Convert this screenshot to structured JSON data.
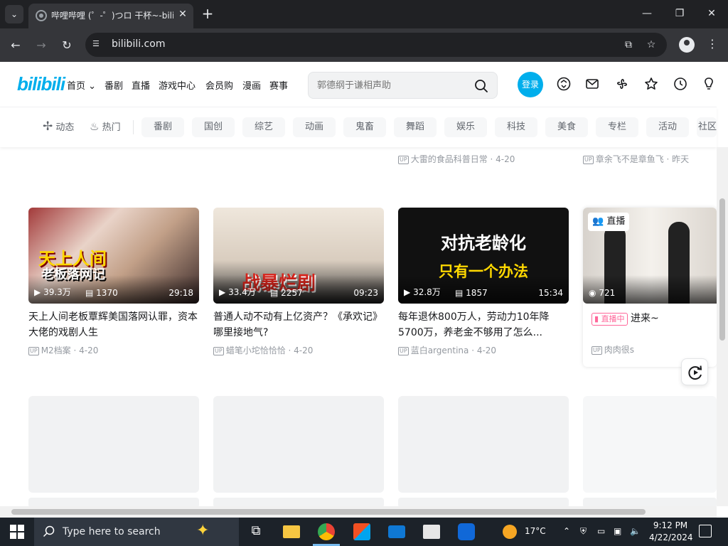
{
  "browser": {
    "tab_title": "哔哩哔哩 (゜-゜)つロ 干杯~-bilibili",
    "url": "bilibili.com"
  },
  "header": {
    "logo": "bilibili",
    "nav": [
      "首页",
      "番剧",
      "直播",
      "游戏中心",
      "会员购",
      "漫画",
      "赛事"
    ],
    "search_placeholder": "郭德纲于谦相声助",
    "login": "登录"
  },
  "channels": {
    "main": [
      "动态",
      "热门"
    ],
    "chips": [
      "番剧",
      "国创",
      "综艺",
      "动画",
      "鬼畜",
      "舞蹈",
      "娱乐",
      "科技",
      "美食",
      "专栏",
      "活动",
      "社区"
    ]
  },
  "top_row_meta": [
    {
      "author": "大雷的食品科普日常",
      "date": "4-20"
    },
    {
      "author": "章余飞不是章鱼飞",
      "date": "昨天"
    }
  ],
  "videos": [
    {
      "title": "天上人间老板覃辉美国落网认罪，资本大佬的戏剧人生",
      "views": "39.3万",
      "danmaku": "1370",
      "duration": "29:18",
      "author": "M2档案",
      "date": "4-20",
      "thumb_text": [
        "天上人间",
        "老板落网记"
      ]
    },
    {
      "title": "普通人动不动有上亿资产？《承欢记》哪里接地气?",
      "views": "33.4万",
      "danmaku": "2257",
      "duration": "09:23",
      "author": "蜡笔小坨恰恰恰",
      "date": "4-20",
      "thumb_text": [
        "战暴烂剧"
      ]
    },
    {
      "title": "每年退休800万人，劳动力10年降5700万，养老金不够用了怎么...",
      "views": "32.8万",
      "danmaku": "1857",
      "duration": "15:34",
      "author": "蓝白argentina",
      "date": "4-20",
      "thumb_text": [
        "对抗老龄化",
        "只有一个办法"
      ]
    },
    {
      "live_badge": "直播",
      "viewers": "721",
      "live_tag": "直播中",
      "title": "进来~",
      "author": "肉肉很s"
    }
  ],
  "taskbar": {
    "search": "Type here to search",
    "weather": "17°C",
    "time": "9:12 PM",
    "date": "4/22/2024"
  },
  "colors": {
    "brand": "#00aeec",
    "live_pink": "#ff6699"
  }
}
